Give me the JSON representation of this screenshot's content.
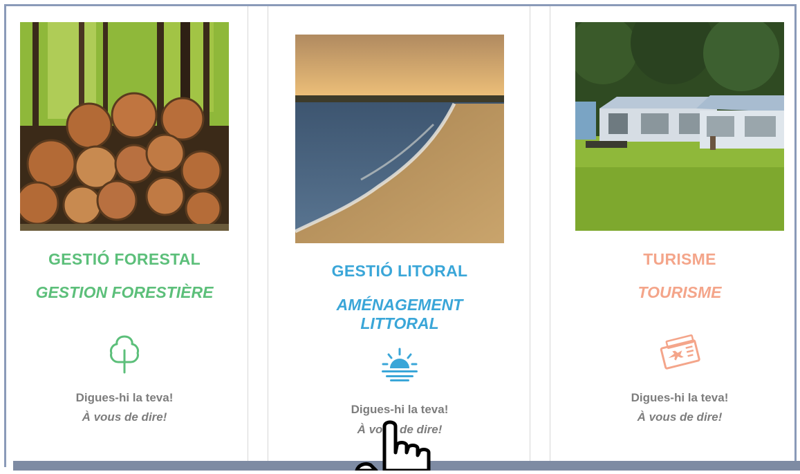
{
  "colors": {
    "forest": "#5cbf7a",
    "coast": "#3aa6d8",
    "tourism": "#f4a58a",
    "cta": "#7d7d7d",
    "frame": "#8a9ab8"
  },
  "cards": [
    {
      "title_ca": "GESTIÓ FORESTAL",
      "title_fr": "GESTION FORESTIÈRE",
      "icon": "tree-icon",
      "cta_ca": "Digues-hi la teva!",
      "cta_fr": "À vous de dire!"
    },
    {
      "title_ca": "GESTIÓ LITORAL",
      "title_fr": "AMÉNAGEMENT LITTORAL",
      "icon": "sunset-icon",
      "cta_ca": "Digues-hi la teva!",
      "cta_fr": "À vous de dire!"
    },
    {
      "title_ca": "TURISME",
      "title_fr": "TOURISME",
      "icon": "travel-ticket-icon",
      "cta_ca": "Digues-hi la teva!",
      "cta_fr": "À vous de dire!"
    }
  ]
}
